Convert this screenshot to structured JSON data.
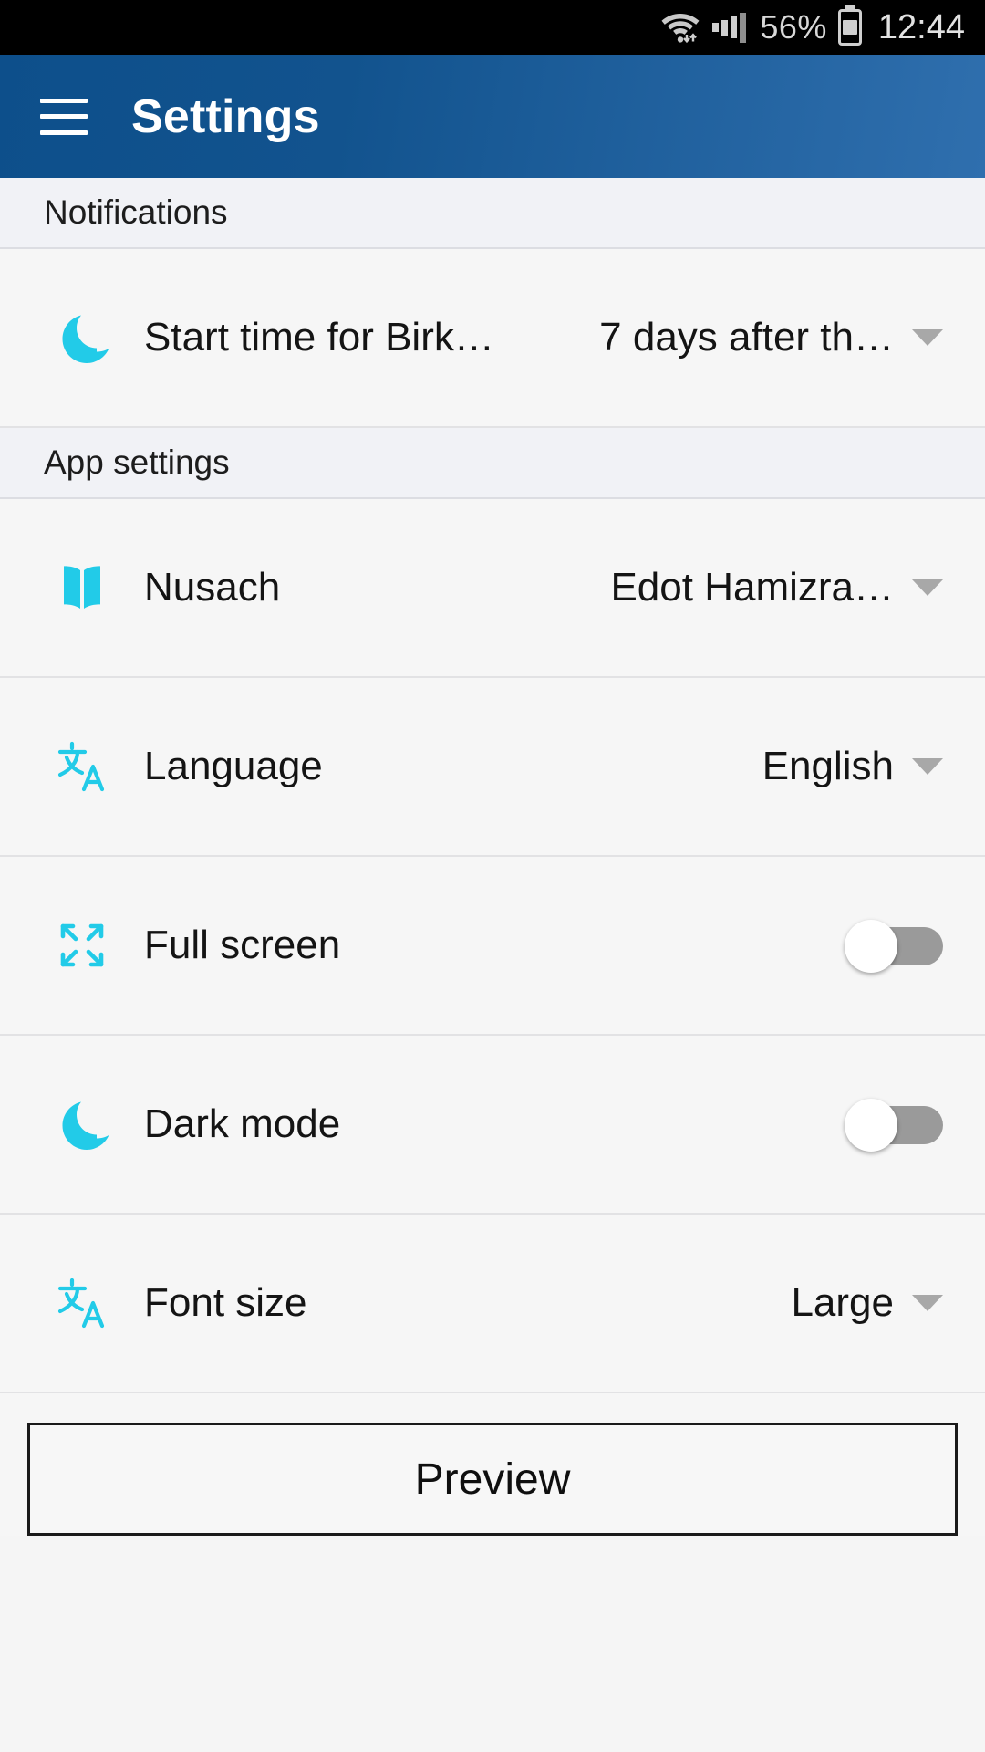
{
  "status_bar": {
    "wifi_icon": "wifi-icon",
    "signal_icon": "cellular-signal-icon",
    "battery_percent": "56%",
    "battery_icon": "battery-icon",
    "time": "12:44"
  },
  "app_bar": {
    "menu_icon": "hamburger-menu-icon",
    "title": "Settings"
  },
  "sections": [
    {
      "header": "Notifications"
    },
    {
      "header": "App settings"
    }
  ],
  "rows": {
    "start_time": {
      "icon": "moon-icon",
      "label": "Start time for Birk…",
      "value": "7 days after th…",
      "control": "dropdown"
    },
    "nusach": {
      "icon": "book-icon",
      "label": "Nusach",
      "value": "Edot Hamizra…",
      "control": "dropdown"
    },
    "language": {
      "icon": "translate-icon",
      "label": "Language",
      "value": "English",
      "control": "dropdown"
    },
    "full_screen": {
      "icon": "fullscreen-icon",
      "label": "Full screen",
      "value": "off",
      "control": "toggle"
    },
    "dark_mode": {
      "icon": "moon-icon",
      "label": "Dark mode",
      "value": "off",
      "control": "toggle"
    },
    "font_size": {
      "icon": "translate-icon",
      "label": "Font size",
      "value": "Large",
      "control": "dropdown"
    }
  },
  "preview_button": {
    "label": "Preview"
  },
  "colors": {
    "accent_cyan": "#22cbe8",
    "app_bar_blue_dark": "#0d4f8b",
    "app_bar_blue_light": "#2f6fae",
    "row_background": "#f6f6f6",
    "section_background": "#f1f2f6",
    "toggle_track_off": "#9a9a9a"
  }
}
